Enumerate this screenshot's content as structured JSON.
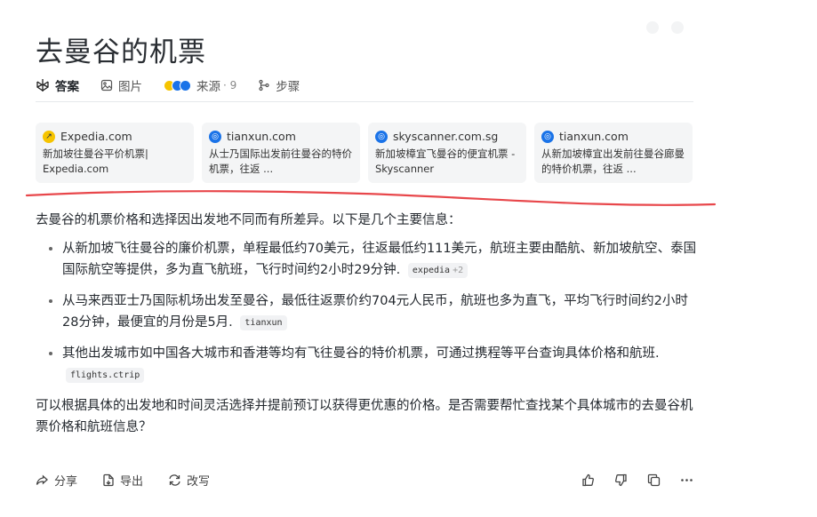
{
  "query_title": "去曼谷的机票",
  "tabs": [
    {
      "label": "答案",
      "icon": "perplexity-icon"
    },
    {
      "label": "图片",
      "icon": "image-icon"
    },
    {
      "label": "来源",
      "icon": "sources-icon",
      "count": "· 9"
    },
    {
      "label": "步骤",
      "icon": "steps-icon"
    }
  ],
  "sources": [
    {
      "site": "Expedia.com",
      "title": "新加坡往曼谷平价机票| Expedia.com",
      "logo_color": "#f6c400"
    },
    {
      "site": "tianxun.com",
      "title": "从士乃国际出发前往曼谷的特价机票，往返 ...",
      "logo_color": "#1a73e8"
    },
    {
      "site": "skyscanner.com.sg",
      "title": "新加坡樟宜飞曼谷的便宜机票 - Skyscanner",
      "logo_color": "#1a73e8"
    },
    {
      "site": "tianxun.com",
      "title": "从新加坡樟宜出发前往曼谷廊曼的特价机票，往返 ...",
      "logo_color": "#1a73e8"
    }
  ],
  "answer": {
    "intro": "去曼谷的机票价格和选择因出发地不同而有所差异。以下是几个主要信息：",
    "bullets": [
      {
        "text": "从新加坡飞往曼谷的廉价机票，单程最低约70美元，往返最低约111美元，航班主要由酷航、新加坡航空、泰国国际航空等提供，多为直飞航班，飞行时间约2小时29分钟.",
        "cite": "expedia",
        "cite_extra": "+2"
      },
      {
        "text": "从马来西亚士乃国际机场出发至曼谷，最低往返票价约704元人民币，航班也多为直飞，平均飞行时间约2小时28分钟，最便宜的月份是5月.",
        "cite": "tianxun",
        "cite_extra": ""
      },
      {
        "text": "其他出发城市如中国各大城市和香港等均有飞往曼谷的特价机票，可通过携程等平台查询具体价格和航班.",
        "cite": "flights.ctrip",
        "cite_extra": ""
      }
    ],
    "closing": "可以根据具体的出发地和时间灵活选择并提前预订以获得更优惠的价格。是否需要帮忙查找某个具体城市的去曼谷机票价格和航班信息？"
  },
  "actions": {
    "share": "分享",
    "export": "导出",
    "rewrite": "改写"
  },
  "colors": {
    "annotation": "#e8474b",
    "accent": "#20808d"
  }
}
